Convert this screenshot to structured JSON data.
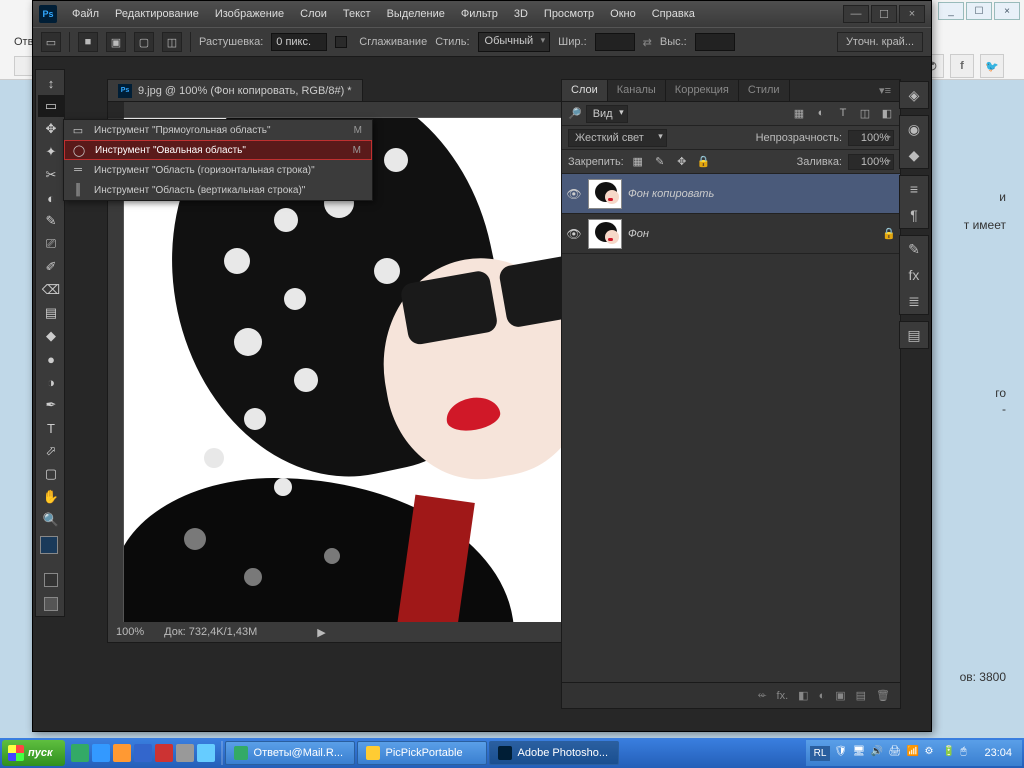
{
  "browser": {
    "tab_hint": "Отв",
    "win_min": "_",
    "win_max": "☐",
    "win_close": "×",
    "home": "⌂",
    "social": [
      "✆",
      "f",
      "🐦"
    ]
  },
  "bg_text": {
    "l1": "и",
    "l2": "т имеет",
    "l3": "го",
    "l4": "-",
    "l5": "ов: 3800"
  },
  "ps": {
    "logo": "Ps",
    "menu": [
      "Файл",
      "Редактирование",
      "Изображение",
      "Слои",
      "Текст",
      "Выделение",
      "Фильтр",
      "3D",
      "Просмотр",
      "Окно",
      "Справка"
    ],
    "win": {
      "min": "—",
      "max": "☐",
      "close": "×"
    },
    "options": {
      "feather_label": "Растушевка:",
      "feather_value": "0 пикс.",
      "antialias": "Сглаживание",
      "style_label": "Стиль:",
      "style_value": "Обычный",
      "width_label": "Шир.:",
      "swap": "⇄",
      "height_label": "Выс.:",
      "refine": "Уточн. край..."
    },
    "doc": {
      "title": "9.jpg @ 100% (Фон копировать, RGB/8#) *",
      "zoom": "100%",
      "status": "Док: 732,4K/1,43M",
      "play": "▶"
    },
    "flyout": [
      {
        "icon": "▭",
        "label": "Инструмент \"Прямоугольная область\"",
        "key": "M"
      },
      {
        "icon": "◯",
        "label": "Инструмент \"Овальная область\"",
        "key": "M"
      },
      {
        "icon": "═",
        "label": "Инструмент \"Область (горизонтальная строка)\"",
        "key": ""
      },
      {
        "icon": "║",
        "label": "Инструмент \"Область (вертикальная строка)\"",
        "key": ""
      }
    ],
    "tools": [
      "↕",
      "▭",
      "✥",
      "✦",
      "✂",
      "◐",
      "✎",
      "⎚",
      "✐",
      "⌫",
      "▤",
      "◆",
      "●",
      "◑",
      "✒",
      "T",
      "⬀",
      "▢",
      "✋",
      "🔍"
    ],
    "panels": {
      "tabs": [
        "Слои",
        "Каналы",
        "Коррекция",
        "Стили"
      ],
      "filter_label": "Вид",
      "filter_icons": [
        "▦",
        "◐",
        "T",
        "◫",
        "◧"
      ],
      "blend": "Жесткий свет",
      "opacity_label": "Непрозрачность:",
      "opacity": "100%",
      "lock_label": "Закрепить:",
      "lock_icons": [
        "▦",
        "✎",
        "✥",
        "🔒"
      ],
      "fill_label": "Заливка:",
      "fill": "100%",
      "layers": [
        {
          "name": "Фон копировать",
          "locked": false
        },
        {
          "name": "Фон",
          "locked": true
        }
      ],
      "footer_icons": [
        "⬰",
        "fx.",
        "◧",
        "◐",
        "▣",
        "▤",
        "🗑"
      ]
    },
    "iconstrip": [
      [
        "◈"
      ],
      [
        "◉",
        "◆"
      ],
      [
        "≡",
        "¶"
      ],
      [
        "✎",
        "fx",
        "≣"
      ],
      [
        "▤"
      ]
    ]
  },
  "taskbar": {
    "start": "пуск",
    "tasks": [
      {
        "label": "Ответы@Mail.R...",
        "active": false
      },
      {
        "label": "PicPickPortable",
        "active": false
      },
      {
        "label": "Adobe Photosho...",
        "active": true
      }
    ],
    "lang": "RL",
    "clock": "23:04"
  }
}
